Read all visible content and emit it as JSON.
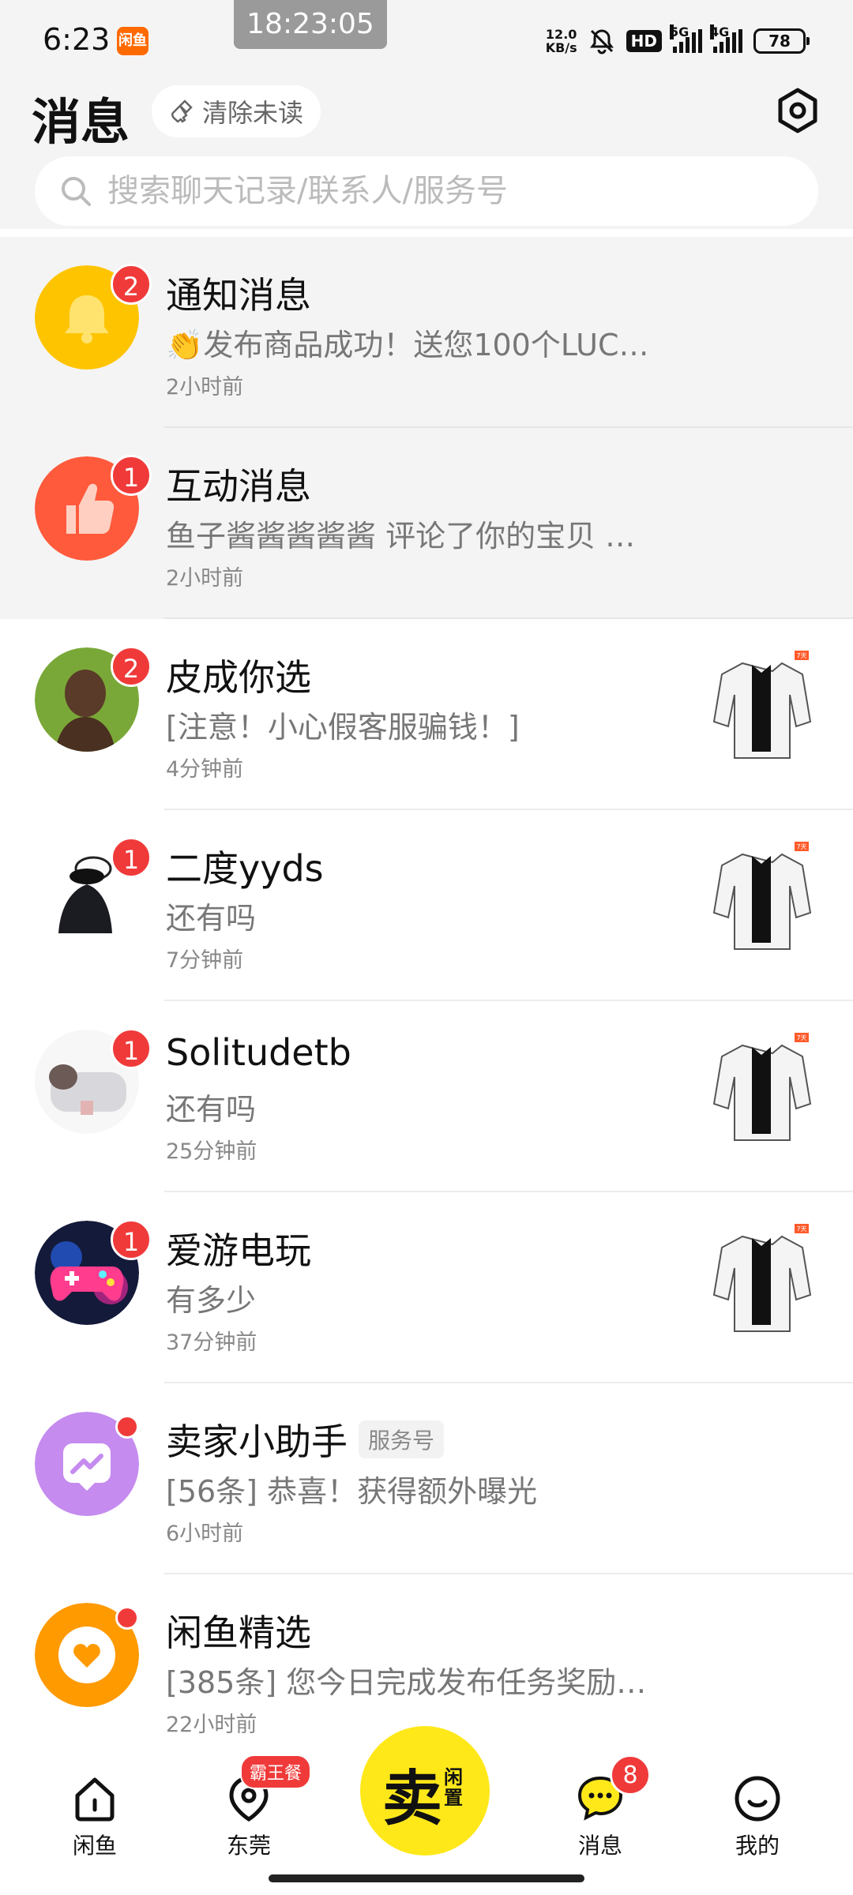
{
  "status_bar": {
    "time": "6:23",
    "app_icon_text": "闲鱼",
    "clock": "18:23:05",
    "net_speed_value": "12.0",
    "net_speed_unit": "KB/s",
    "hd_label": "HD",
    "network_5g": "5G",
    "network_4g": "4G",
    "battery": "78"
  },
  "header": {
    "title": "消息",
    "clear_unread_label": "清除未读",
    "settings_icon": "settings-icon"
  },
  "search": {
    "placeholder": "搜索聊天记录/联系人/服务号"
  },
  "conversations": [
    {
      "name": "通知消息",
      "preview": "👏发布商品成功！送您100个LUC…",
      "time": "2小时前",
      "badge": "2",
      "pinned": true,
      "avatar_color": "#ffc400"
    },
    {
      "name": "互动消息",
      "preview": "鱼子酱酱酱酱酱 评论了你的宝贝 …",
      "time": "2小时前",
      "badge": "1",
      "pinned": true,
      "avatar_color": "#ff5a3c"
    },
    {
      "name": "皮成你选",
      "preview": "[注意！小心假客服骗钱！]",
      "time": "4分钟前",
      "badge": "2",
      "thumb_label": "7天"
    },
    {
      "name": "二度yyds",
      "preview": "还有吗",
      "time": "7分钟前",
      "badge": "1",
      "thumb_label": "7天"
    },
    {
      "name": "Solitudetb",
      "preview": "还有吗",
      "time": "25分钟前",
      "badge": "1",
      "thumb_label": "7天"
    },
    {
      "name": "爱游电玩",
      "preview": "有多少",
      "time": "37分钟前",
      "badge": "1",
      "thumb_label": "7天"
    },
    {
      "name": "卖家小助手",
      "tag": "服务号",
      "preview": "[56条] 恭喜！获得额外曝光",
      "time": "6小时前",
      "dot": true,
      "avatar_color": "#c58bef"
    },
    {
      "name": "闲鱼精选",
      "preview": "[385条] 您今日完成发布任务奖励…",
      "time": "22小时前",
      "dot": true,
      "avatar_color": "#ff9a00"
    }
  ],
  "bottom_nav": {
    "home": "闲鱼",
    "location": "东莞",
    "location_badge": "霸王餐",
    "sell_main": "卖",
    "sell_sub": "闲置",
    "messages": "消息",
    "messages_badge": "8",
    "profile": "我的",
    "accent": "#ffe81a"
  }
}
